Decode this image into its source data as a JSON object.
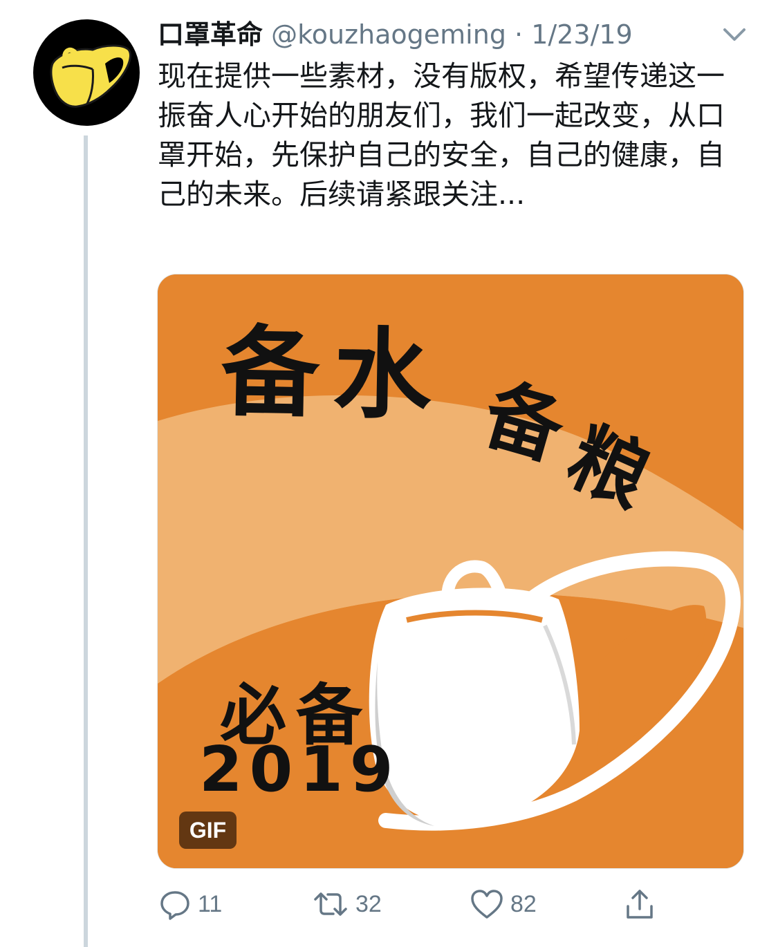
{
  "tweet": {
    "author": {
      "display_name": "口罩革命",
      "handle": "@kouzhaogeming",
      "avatar_icon": "mask-avatar-icon"
    },
    "separator": "·",
    "date": "1/23/19",
    "text": "现在提供一些素材，没有版权，希望传递这一振奋人心开始的朋友们，我们一起改变，从口罩开始，先保护自己的安全，自己的健康，自己的未来。后续请紧跟关注...",
    "media": {
      "badge": "GIF",
      "overlay_text": {
        "line1": "备水",
        "line2a": "备",
        "line2b": "粮",
        "line3": "必备",
        "year": "2019"
      },
      "colors": {
        "background": "#e5862f",
        "band": "#f0b270",
        "mask": "#ffffff"
      }
    },
    "actions": {
      "reply": {
        "icon": "reply-icon",
        "count": "11"
      },
      "retweet": {
        "icon": "retweet-icon",
        "count": "32"
      },
      "like": {
        "icon": "heart-icon",
        "count": "82"
      },
      "share": {
        "icon": "share-icon"
      }
    }
  }
}
